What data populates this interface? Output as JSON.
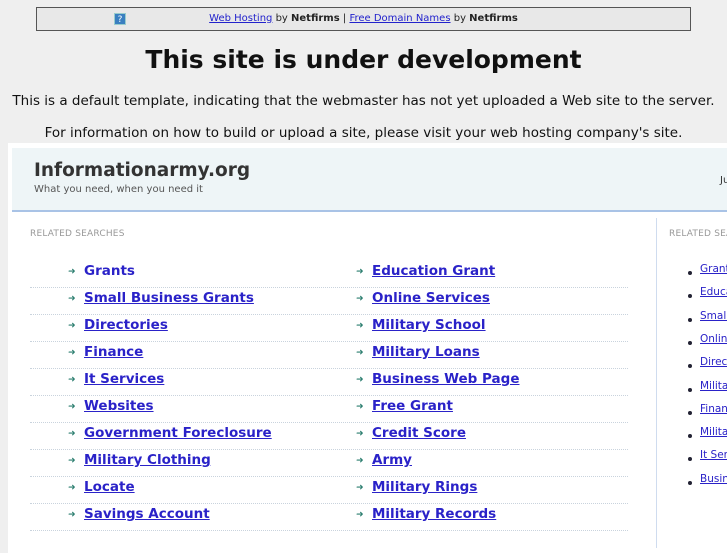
{
  "topbar": {
    "link1": "Web Hosting",
    "by1": "by",
    "brand1": "Netfirms",
    "sep": "|",
    "link2": "Free Domain Names",
    "by2": "by",
    "brand2": "Netfirms",
    "help_icon": "?"
  },
  "heading": "This site is under development",
  "info1": "This is a default template, indicating that the webmaster has not yet uploaded a Web site to the server.",
  "info2": "For information on how to build or upload a site, please visit your web hosting company's site.",
  "site": {
    "title": "Informationarmy.org",
    "tagline": "What you need, when you need it",
    "right_text": "Ju"
  },
  "main": {
    "label": "RELATED SEARCHES",
    "left": [
      "Grants",
      "Small Business Grants",
      "Directories",
      "Finance",
      "It Services",
      "Websites",
      "Government Foreclosure",
      "Military Clothing",
      "Locate",
      "Savings Account"
    ],
    "right": [
      "Education Grant",
      "Online Services",
      "Military School",
      "Military Loans",
      "Business Web Page",
      "Free Grant",
      "Credit Score",
      "Army",
      "Military Rings",
      "Military Records"
    ]
  },
  "sidebar": {
    "label": "RELATED SEA",
    "items": [
      "Grants",
      "Education Grant",
      "Small Business Grants",
      "Online Services",
      "Directories",
      "Military School",
      "Finance",
      "Military Loans",
      "It Services",
      "Business Web Page"
    ]
  },
  "colors": {
    "link": "#2a22c8",
    "header_bg": "#eef5f7"
  }
}
